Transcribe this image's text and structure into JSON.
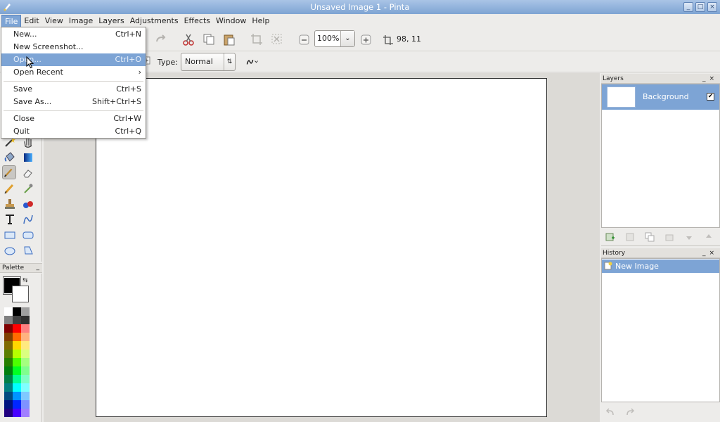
{
  "window": {
    "title": "Unsaved Image 1 - Pinta"
  },
  "menubar": [
    "File",
    "Edit",
    "View",
    "Image",
    "Layers",
    "Adjustments",
    "Effects",
    "Window",
    "Help"
  ],
  "file_menu": {
    "new": {
      "label": "New...",
      "shortcut": "Ctrl+N"
    },
    "new_screenshot": {
      "label": "New Screenshot..."
    },
    "open": {
      "label": "Open...",
      "shortcut": "Ctrl+O"
    },
    "open_recent": {
      "label": "Open Recent"
    },
    "save": {
      "label": "Save",
      "shortcut": "Ctrl+S"
    },
    "save_as": {
      "label": "Save As...",
      "shortcut": "Shift+Ctrl+S"
    },
    "close": {
      "label": "Close",
      "shortcut": "Ctrl+W"
    },
    "quit": {
      "label": "Quit",
      "shortcut": "Ctrl+Q"
    }
  },
  "toolbar": {
    "zoom": "100%",
    "coords": "98, 11"
  },
  "tool_options": {
    "type_label": "Type:",
    "type_value": "Normal"
  },
  "palette": {
    "title": "Palette",
    "primary": "#000000",
    "secondary": "#ffffff",
    "swatches": [
      "#ffffff",
      "#000000",
      "#a0a0a0",
      "#808080",
      "#404040",
      "#303030",
      "#7f0000",
      "#ff0000",
      "#ff7f7f",
      "#7f3f00",
      "#ff6a00",
      "#ffb27f",
      "#7f6a00",
      "#ffd800",
      "#ffe97f",
      "#5b7f00",
      "#b6ff00",
      "#daff7f",
      "#267f00",
      "#4cff00",
      "#a5ff7f",
      "#007f0e",
      "#00ff21",
      "#7fff8e",
      "#007f46",
      "#00ff90",
      "#7fffc5",
      "#007f7f",
      "#00ffff",
      "#7fffff",
      "#004a7f",
      "#0094ff",
      "#7fc9ff",
      "#00137f",
      "#0026ff",
      "#7f92ff",
      "#21007f",
      "#4800ff",
      "#a17fff"
    ]
  },
  "layers": {
    "title": "Layers",
    "items": [
      {
        "name": "Background",
        "visible": true
      }
    ]
  },
  "history": {
    "title": "History",
    "items": [
      "New Image"
    ]
  },
  "colors": {
    "accent": "#7da4d5",
    "titlebar": "#7ea4d3"
  }
}
